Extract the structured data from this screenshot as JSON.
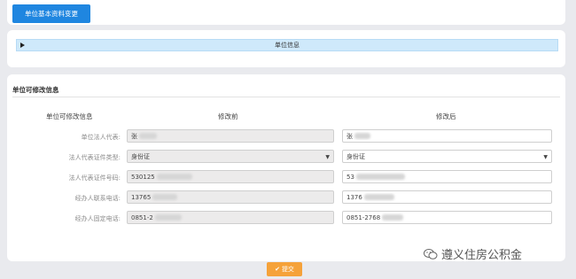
{
  "tab": {
    "label": "单位基本资料变更"
  },
  "info_section": {
    "title": "单位信息"
  },
  "modifiable": {
    "title": "单位可修改信息",
    "headers": {
      "field": "单位可修改信息",
      "before": "修改前",
      "after": "修改后"
    },
    "rows": [
      {
        "label": "单位法人代表:",
        "before": "张",
        "after": "张"
      },
      {
        "label": "法人代表证件类型:",
        "before": "身份证",
        "after": "身份证"
      },
      {
        "label": "法人代表证件号码:",
        "before": "530125",
        "after": "53"
      },
      {
        "label": "经办人联系电话:",
        "before": "13765",
        "after": "1376"
      },
      {
        "label": "经办人固定电话:",
        "before": "0851-2",
        "after": "0851-2768"
      }
    ]
  },
  "submit": {
    "label": "提交",
    "icon": "check-icon"
  },
  "watermark": {
    "text": "遵义住房公积金",
    "icon": "wechat-icon"
  },
  "colors": {
    "primary": "#1f86e0",
    "info_bar": "#cfe9fb",
    "submit": "#f5a23a"
  }
}
